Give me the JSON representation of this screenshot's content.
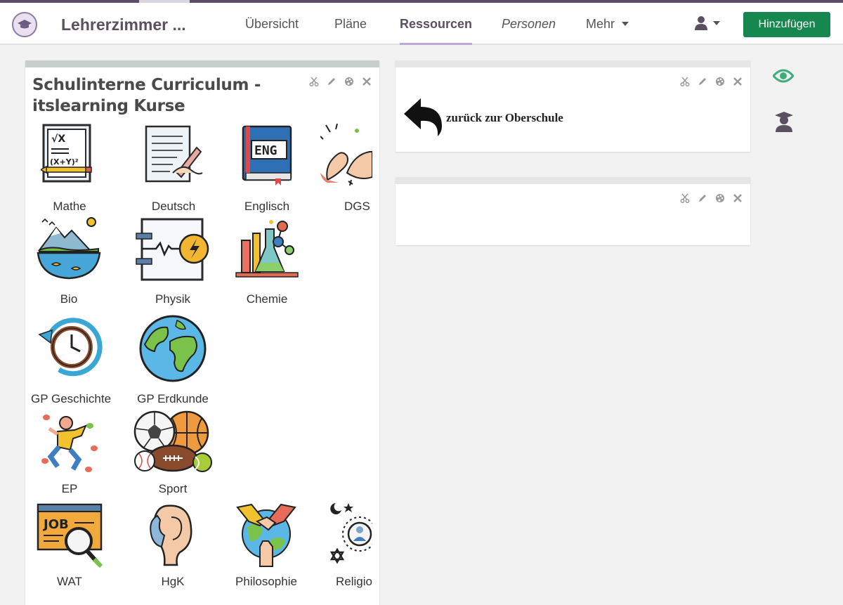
{
  "header": {
    "title": "Lehrerzimmer ...",
    "nav": {
      "overview": "Übersicht",
      "plans": "Pläne",
      "resources": "Ressourcen",
      "people": "Personen",
      "more": "Mehr"
    },
    "add_button": "Hinzufügen"
  },
  "panel_left": {
    "title": "Schulinterne Curriculum - itslearning Kurse",
    "tiles": {
      "mathe": "Mathe",
      "deutsch": "Deutsch",
      "englisch": "Englisch",
      "englisch_badge": "ENG",
      "dgs": "DGS",
      "bio": "Bio",
      "physik": "Physik",
      "chemie": "Chemie",
      "geschichte": "GP Geschichte",
      "erdkunde": "GP Erdkunde",
      "ep": "EP",
      "sport": "Sport",
      "wat": "WAT",
      "wat_badge": "JOB",
      "hgk": "HgK",
      "philosophie": "Philosophie",
      "religion": "Religion"
    }
  },
  "panel_right_1": {
    "link_text": "zurück zur Oberschule"
  },
  "icons": {
    "logo": "graduation-cap-icon",
    "user": "user-icon",
    "eye": "eye-icon",
    "teacher": "teacher-icon",
    "panel_tools": [
      "scissors-icon",
      "pencil-icon",
      "palette-icon",
      "close-icon"
    ]
  },
  "colors": {
    "accent": "#16874f",
    "nav_underline": "#bfa8d4",
    "eye": "#3fae7a",
    "brand": "#5a5060"
  }
}
